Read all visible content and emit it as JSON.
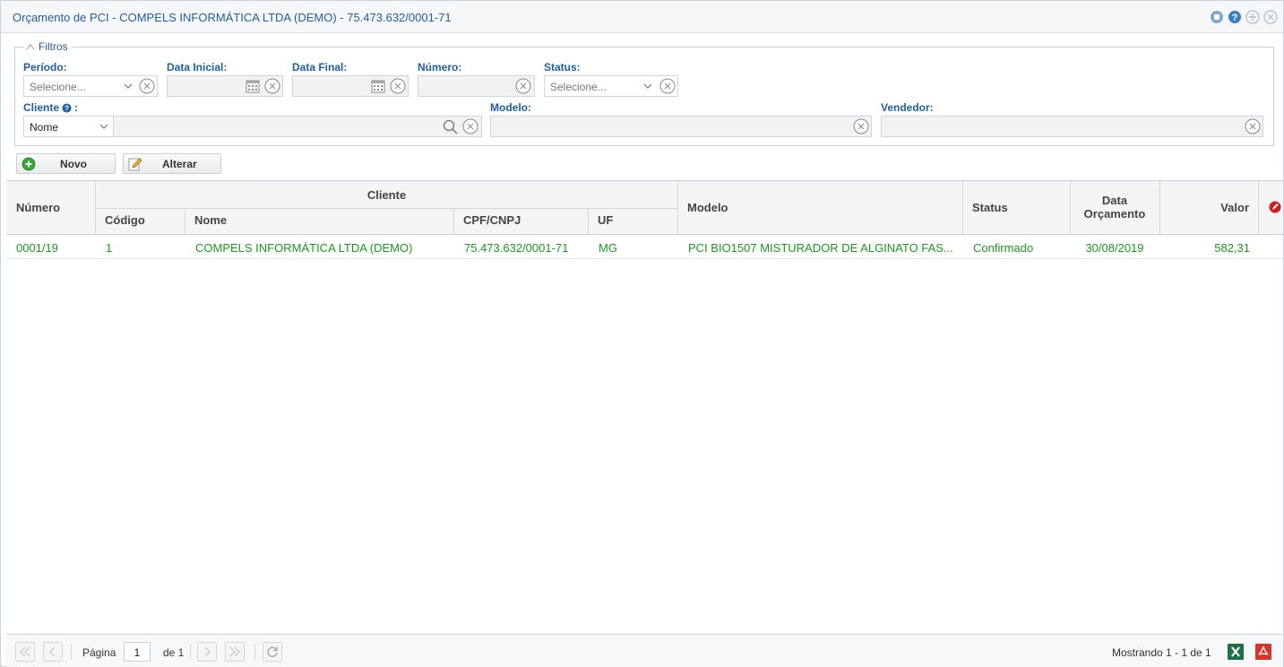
{
  "window": {
    "title": "Orçamento de PCI - COMPELS INFORMÁTICA LTDA (DEMO) - 75.473.632/0001-71"
  },
  "filters": {
    "legend": "Filtros",
    "periodo": {
      "label": "Período:",
      "placeholder": "Selecione..."
    },
    "data_inicial": {
      "label": "Data Inicial:",
      "value": ""
    },
    "data_final": {
      "label": "Data Final:",
      "value": ""
    },
    "numero": {
      "label": "Número:",
      "value": ""
    },
    "status": {
      "label": "Status:",
      "placeholder": "Selecione..."
    },
    "cliente": {
      "label": "Cliente",
      "type_value": "Nome",
      "value": ""
    },
    "modelo": {
      "label": "Modelo:",
      "value": ""
    },
    "vendedor": {
      "label": "Vendedor:",
      "value": ""
    }
  },
  "toolbar": {
    "novo_label": "Novo",
    "alterar_label": "Alterar"
  },
  "grid": {
    "headers": {
      "numero": "Número",
      "cliente_group": "Cliente",
      "codigo": "Código",
      "nome": "Nome",
      "cpf_cnpj": "CPF/CNPJ",
      "uf": "UF",
      "modelo": "Modelo",
      "status": "Status",
      "data_orcamento_line1": "Data",
      "data_orcamento_line2": "Orçamento",
      "valor": "Valor"
    },
    "rows": [
      {
        "numero": "0001/19",
        "codigo": "1",
        "nome": "COMPELS INFORMÁTICA LTDA (DEMO)",
        "cpf_cnpj": "75.473.632/0001-71",
        "uf": "MG",
        "modelo": "PCI BIO1507 MISTURADOR DE ALGINATO FAS...",
        "status": "Confirmado",
        "data_orcamento": "30/08/2019",
        "valor": "582,31"
      }
    ]
  },
  "pager": {
    "pagina_label": "Página",
    "page_value": "1",
    "de_label": "de 1",
    "mostrando": "Mostrando 1 - 1 de 1"
  },
  "colors": {
    "title": "#1f5fa0",
    "row_text": "#1a9a1a",
    "excel": "#1e7145",
    "pdf": "#d9342b"
  }
}
